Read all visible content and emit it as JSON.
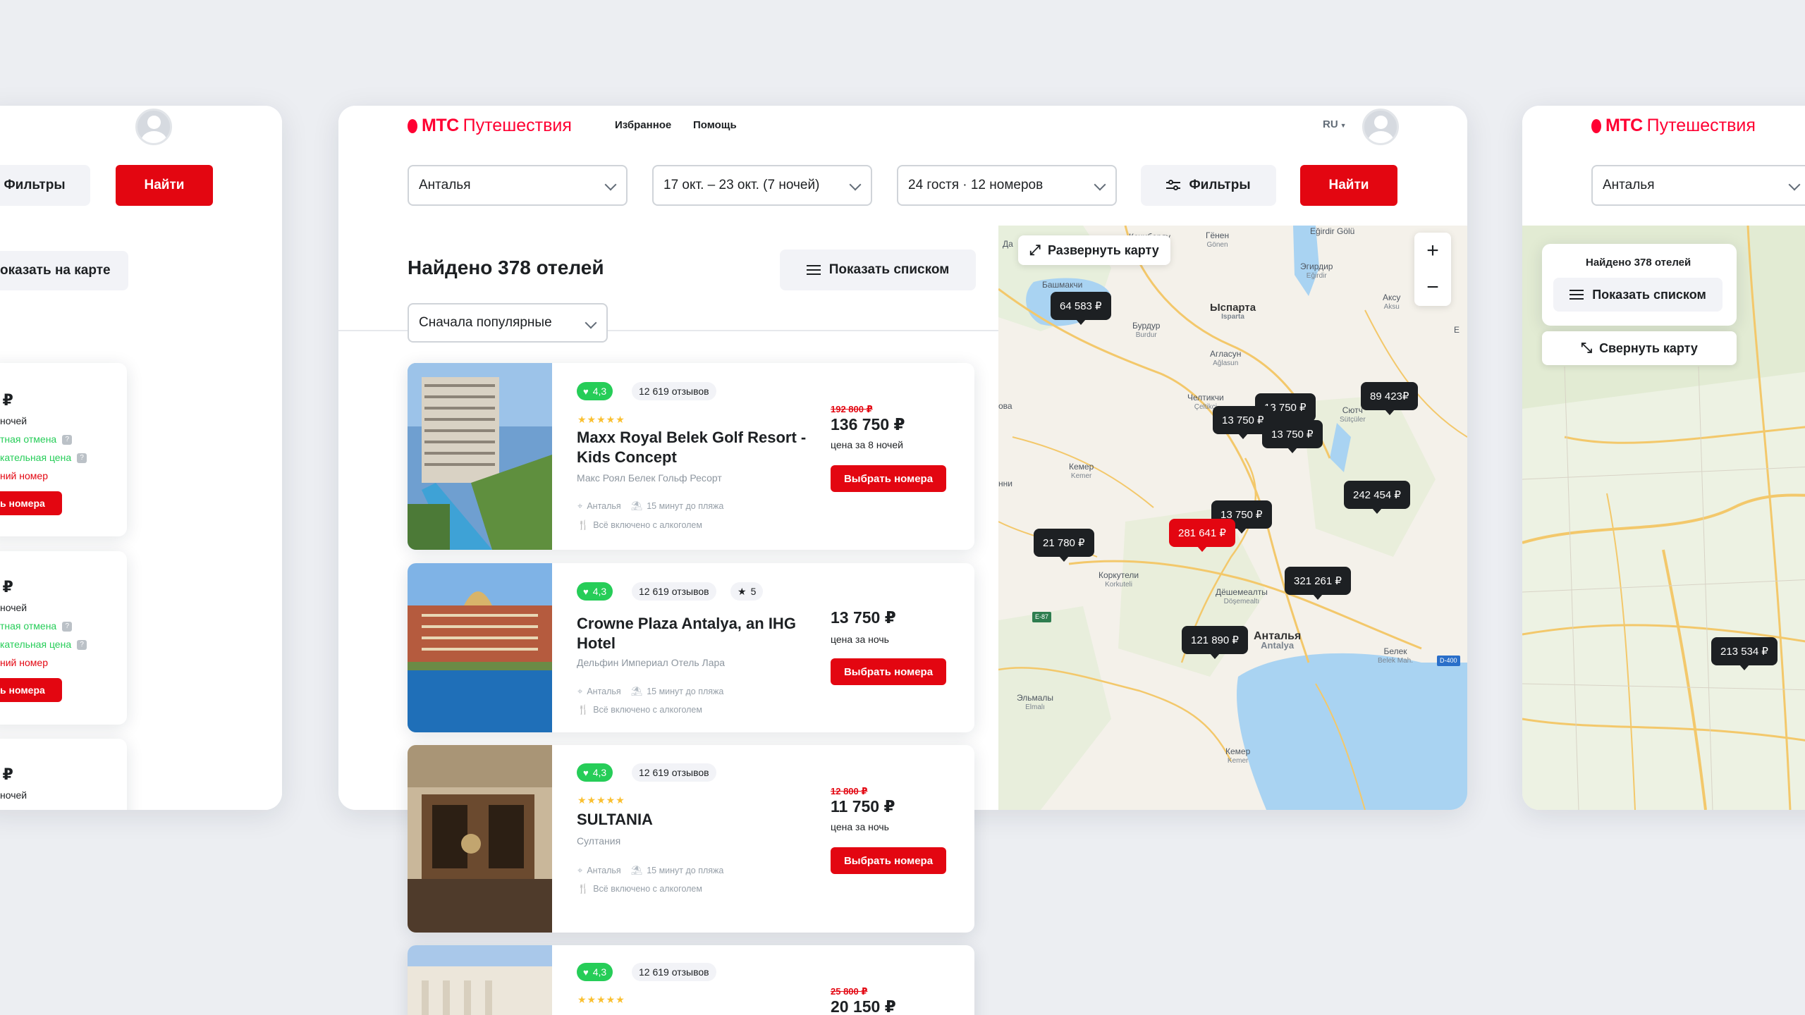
{
  "brand": {
    "logo_text": "МТС",
    "service_name": "Путешествия",
    "accent": "#e30611"
  },
  "nav": {
    "favorites": "Избранное",
    "help": "Помощь",
    "lang": "RU"
  },
  "search": {
    "destination": "Анталья",
    "dates": "17 окт. – 23 окт. (7 ночей)",
    "guests": "24 гостя · 12 номеров",
    "filters_label": "Фильтры",
    "find_label": "Найти"
  },
  "results": {
    "title": "Найдено 378 отелей",
    "show_list_label": "Показать списком",
    "show_on_map_label": "Показать на карте",
    "sort_label": "Сначала популярные"
  },
  "hotels": [
    {
      "rating": "4,3",
      "reviews": "12 619 отзывов",
      "stars": "★★★★★",
      "name": "Maxx Royal Belek Golf Resort - Kids Concept",
      "subtitle": "Макс Роял Белек Гольф Ресорт",
      "location": "Анталья",
      "beach": "15 минут до пляжа",
      "meals": "Всё включено с алкоголем",
      "old_price": "192 800 ₽",
      "price": "136 750 ₽",
      "price_note": "цена за 8 ночей",
      "cta": "Выбрать номера"
    },
    {
      "rating": "4,3",
      "reviews": "12 619 отзывов",
      "star_count": "5",
      "name": "Crowne Plaza Antalya, an IHG Hotel",
      "subtitle": "Дельфин Империал Отель Лара",
      "location": "Анталья",
      "beach": "15 минут до пляжа",
      "meals": "Всё включено с алкоголем",
      "price": "13 750 ₽",
      "price_note": "цена за ночь",
      "cta": "Выбрать номера"
    },
    {
      "rating": "4,3",
      "reviews": "12 619 отзывов",
      "stars": "★★★★★",
      "name": "SULTANIA",
      "subtitle": "Султания",
      "location": "Анталья",
      "beach": "15 минут до пляжа",
      "meals": "Всё включено с алкоголем",
      "old_price": "12 800 ₽",
      "price": "11 750 ₽",
      "price_note": "цена за ночь",
      "cta": "Выбрать номера"
    },
    {
      "rating": "4,3",
      "reviews": "12 619 отзывов",
      "stars": "★★★★★",
      "old_price": "25 800 ₽",
      "price": "20 150 ₽"
    }
  ],
  "map": {
    "expand_label": "Развернуть карту",
    "collapse_label": "Свернуть карту",
    "found_label": "Найдено 378 отелей",
    "zoom_in": "+",
    "zoom_out": "−",
    "pins": [
      "64 583 ₽",
      "13 750 ₽",
      "13 750 ₽",
      "13 750 ₽",
      "89 423₽",
      "242 454 ₽",
      "13 750 ₽",
      "281 641 ₽",
      "21 780 ₽",
      "321 261 ₽",
      "121 890 ₽",
      "213 534 ₽"
    ],
    "places": {
      "kechiborlu": "Кечиборлу",
      "genen": "Гёнен",
      "genen_lat": "Gönen",
      "egirdir_lake": "Eğirdir Gölü",
      "egirdir": "Эгирдир",
      "egirdir_lat": "Eğirdir",
      "bashmakchi": "Башмакчи",
      "isparta": "Ыспарта",
      "isparta_lat": "Isparta",
      "aksu": "Аксу",
      "aksu_lat": "Aksu",
      "burdur": "Бурдур",
      "burdur_lat": "Burdur",
      "aglasun": "Агласун",
      "aglasun_lat": "Ağlasun",
      "chelt": "Челтикчи",
      "chelt_lat": "Çeltikçi",
      "sutch": "Сютч",
      "sutch_lat": "Sütçüler",
      "kemer": "Кемер",
      "kemer_lat": "Kemer",
      "korkuteli": "Коркутели",
      "korkuteli_lat": "Korkuteli",
      "doshemealti": "Дёшемеалты",
      "doshemealti_lat": "Döşemealtı",
      "antalya": "Анталья",
      "antalya_lat": "Antalya",
      "belek": "Белек",
      "belek_lat": "Belek Mah.",
      "elmaly": "Эльмалы",
      "elmaly_lat": "Elmalı",
      "kemer2": "Кемер",
      "kemer2_lat": "Kemer",
      "da": "Да",
      "ova": "ова",
      "nni": "нни",
      "road_e87": "E-87",
      "road_d400": "D-400",
      "road_e": "Е"
    }
  },
  "side_left": {
    "filters_label": "Фильтры",
    "find_label": "Найти",
    "show_on_map": "оказать на карте",
    "items": [
      {
        "price": ") ₽",
        "nights": "ночей",
        "free_cancel": "тная отмена",
        "best_price": "кательная цена",
        "room": "ний номер",
        "cta": "ь номера"
      },
      {
        "price": ") ₽",
        "nights": "ночей",
        "free_cancel": "тная отмена",
        "best_price": "кательная цена",
        "room": "ний номер",
        "cta": "ь номера"
      },
      {
        "price": ") ₽",
        "nights": "ночей"
      }
    ]
  }
}
